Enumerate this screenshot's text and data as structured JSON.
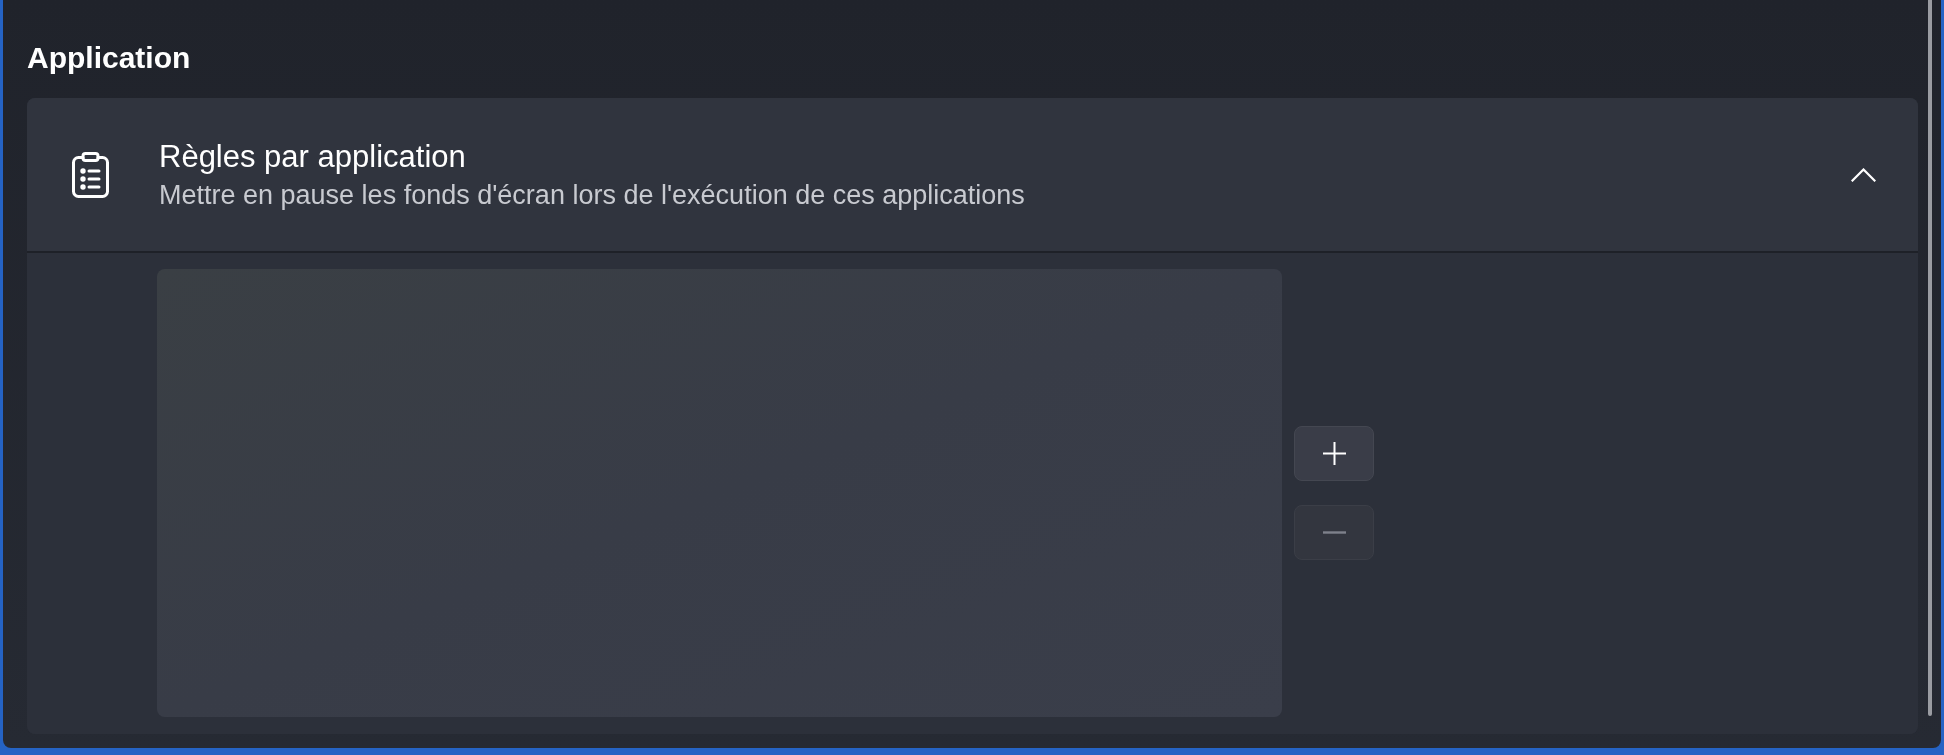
{
  "section": {
    "title": "Application"
  },
  "expander": {
    "title": "Règles par application",
    "description": "Mettre en pause les fonds d'écran lors de l'exécution de ces applications",
    "expanded": true,
    "buttons": [
      {
        "kind": "add",
        "disabled": false
      },
      {
        "kind": "remove",
        "disabled": true
      }
    ]
  }
}
